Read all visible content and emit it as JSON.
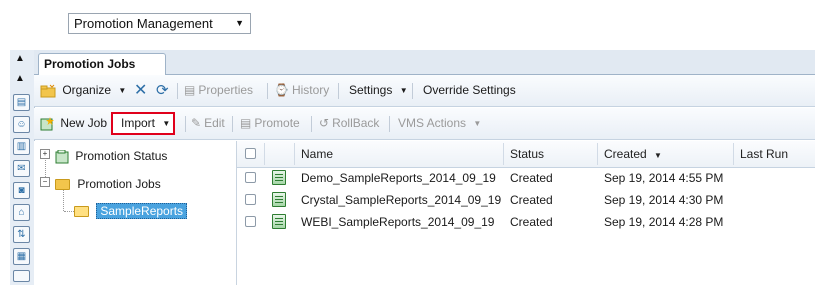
{
  "app_selector": {
    "value": "Promotion Management"
  },
  "tabs": [
    {
      "label": "Promotion Jobs"
    }
  ],
  "toolbar_top": {
    "organize": "Organize",
    "properties": "Properties",
    "history": "History",
    "settings": "Settings",
    "override_settings": "Override Settings"
  },
  "toolbar_actions": {
    "new_job": "New Job",
    "import": "Import",
    "edit": "Edit",
    "promote": "Promote",
    "rollback": "RollBack",
    "vms_actions": "VMS Actions"
  },
  "tree": {
    "promotion_status": "Promotion Status",
    "promotion_jobs": "Promotion Jobs",
    "sample_reports": "SampleReports"
  },
  "table": {
    "columns": {
      "name": "Name",
      "status": "Status",
      "created": "Created",
      "last_run": "Last Run"
    },
    "sorted_column": "created",
    "sort_direction": "descending",
    "rows": [
      {
        "name": "Demo_SampleReports_2014_09_19",
        "status": "Created",
        "created": "Sep 19, 2014 4:55 PM",
        "last_run": ""
      },
      {
        "name": "Crystal_SampleReports_2014_09_19",
        "status": "Created",
        "created": "Sep 19, 2014 4:30 PM",
        "last_run": ""
      },
      {
        "name": "WEBI_SampleReports_2014_09_19",
        "status": "Created",
        "created": "Sep 19, 2014 4:28 PM",
        "last_run": ""
      }
    ]
  },
  "icons": {
    "rail": [
      "collapse-up-icon",
      "scroll-up-icon",
      "folders-icon",
      "users-icon",
      "servers-icon",
      "inbox-icon",
      "database-icon",
      "network-icon",
      "connections-icon",
      "calendar-icon"
    ],
    "accent_color": "#2d6fa7",
    "highlight_color": "#e0001b",
    "selection_color": "#4aa3df"
  }
}
